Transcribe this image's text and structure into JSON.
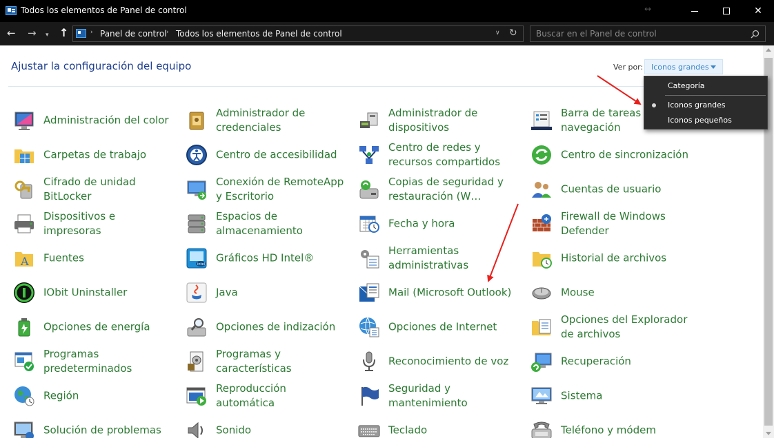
{
  "window": {
    "title": "Todos los elementos de Panel de control",
    "resize_hint": "↔",
    "minimize_label": "Minimizar",
    "maximize_label": "Maximizar",
    "close_label": "✕"
  },
  "nav": {
    "back": "←",
    "forward": "→",
    "recent": "▾",
    "up": "↑"
  },
  "address": {
    "separator": "›",
    "crumbs": [
      "Panel de control",
      "Todos los elementos de Panel de control"
    ],
    "dropdown": "∨",
    "refresh": "↻"
  },
  "search": {
    "placeholder": "Buscar en el Panel de control"
  },
  "header": {
    "title": "Ajustar la configuración del equipo",
    "view_by_label": "Ver por:",
    "view_selected": "Iconos grandes"
  },
  "view_menu": {
    "options": [
      "Categoría",
      "Iconos grandes",
      "Iconos pequeños"
    ],
    "selected": "Iconos grandes"
  },
  "items": [
    {
      "label": "Administración del color",
      "icon": "color-management-icon"
    },
    {
      "label": "Administrador de credenciales",
      "icon": "credential-manager-icon"
    },
    {
      "label": "Administrador de dispositivos",
      "icon": "device-manager-icon"
    },
    {
      "label": "Barra de tareas y navegación",
      "icon": "taskbar-icon"
    },
    {
      "label": "Carpetas de trabajo",
      "icon": "work-folders-icon"
    },
    {
      "label": "Centro de accesibilidad",
      "icon": "accessibility-icon"
    },
    {
      "label": "Centro de redes y recursos compartidos",
      "icon": "network-center-icon"
    },
    {
      "label": "Centro de sincronización",
      "icon": "sync-center-icon"
    },
    {
      "label": "Cifrado de unidad BitLocker",
      "icon": "bitlocker-icon"
    },
    {
      "label": "Conexión de RemoteApp y Escritorio",
      "icon": "remoteapp-icon"
    },
    {
      "label": "Copias de seguridad y restauración (W…",
      "icon": "backup-icon"
    },
    {
      "label": "Cuentas de usuario",
      "icon": "user-accounts-icon"
    },
    {
      "label": "Dispositivos e impresoras",
      "icon": "printer-icon"
    },
    {
      "label": "Espacios de almacenamiento",
      "icon": "storage-spaces-icon"
    },
    {
      "label": "Fecha y hora",
      "icon": "date-time-icon"
    },
    {
      "label": "Firewall de Windows Defender",
      "icon": "firewall-icon"
    },
    {
      "label": "Fuentes",
      "icon": "fonts-icon"
    },
    {
      "label": "Gráficos HD Intel®",
      "icon": "intel-graphics-icon"
    },
    {
      "label": "Herramientas administrativas",
      "icon": "admin-tools-icon"
    },
    {
      "label": "Historial de archivos",
      "icon": "file-history-icon"
    },
    {
      "label": "IObit Uninstaller",
      "icon": "iobit-icon"
    },
    {
      "label": "Java",
      "icon": "java-icon"
    },
    {
      "label": "Mail (Microsoft Outlook)",
      "icon": "mail-icon"
    },
    {
      "label": "Mouse",
      "icon": "mouse-icon"
    },
    {
      "label": "Opciones de energía",
      "icon": "power-options-icon"
    },
    {
      "label": "Opciones de indización",
      "icon": "indexing-icon"
    },
    {
      "label": "Opciones de Internet",
      "icon": "internet-options-icon"
    },
    {
      "label": "Opciones del Explorador de archivos",
      "icon": "explorer-options-icon"
    },
    {
      "label": "Programas predeterminados",
      "icon": "default-programs-icon"
    },
    {
      "label": "Programas y características",
      "icon": "programs-features-icon"
    },
    {
      "label": "Reconocimiento de voz",
      "icon": "microphone-icon"
    },
    {
      "label": "Recuperación",
      "icon": "recovery-icon"
    },
    {
      "label": "Región",
      "icon": "region-icon"
    },
    {
      "label": "Reproducción automática",
      "icon": "autoplay-icon"
    },
    {
      "label": "Seguridad y mantenimiento",
      "icon": "security-flag-icon"
    },
    {
      "label": "Sistema",
      "icon": "system-icon"
    },
    {
      "label": "Solución de problemas",
      "icon": "troubleshooting-icon"
    },
    {
      "label": "Sonido",
      "icon": "sound-icon"
    },
    {
      "label": "Teclado",
      "icon": "keyboard-icon"
    },
    {
      "label": "Teléfono y módem",
      "icon": "phone-modem-icon"
    }
  ],
  "colors": {
    "item_text": "#2c7a32",
    "heading": "#1e3e8e",
    "annotation_arrow": "#e8201c",
    "titlebar": "#000000",
    "menu_bg": "#2b2b2b"
  }
}
